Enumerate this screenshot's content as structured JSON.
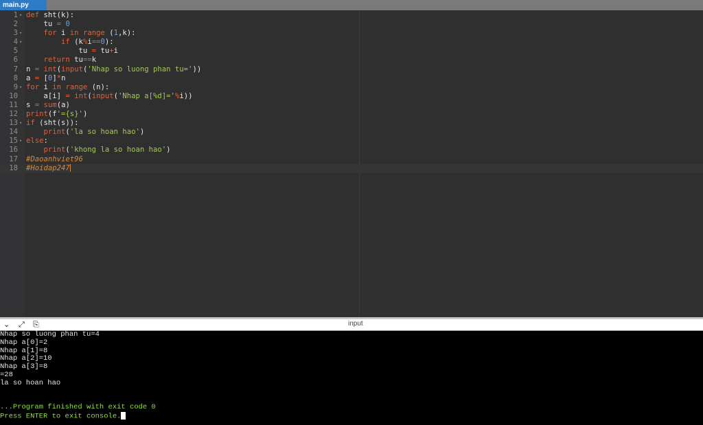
{
  "tab": {
    "label": "main.py"
  },
  "editor": {
    "active_line": 18,
    "folds": [
      1,
      3,
      4,
      9,
      13,
      15
    ],
    "lines": [
      [
        [
          "k",
          "def"
        ],
        [
          "p",
          " sht(k):"
        ]
      ],
      [
        [
          "p",
          "    tu "
        ],
        [
          "k",
          "="
        ],
        [
          "p",
          " "
        ],
        [
          "n",
          "0"
        ]
      ],
      [
        [
          "p",
          "    "
        ],
        [
          "k",
          "for"
        ],
        [
          "p",
          " i "
        ],
        [
          "k",
          "in"
        ],
        [
          "p",
          " "
        ],
        [
          "k",
          "range"
        ],
        [
          "p",
          " ("
        ],
        [
          "n",
          "1"
        ],
        [
          "p",
          ",k):"
        ]
      ],
      [
        [
          "p",
          "        "
        ],
        [
          "k",
          "if"
        ],
        [
          "p",
          " (k"
        ],
        [
          "k",
          "%"
        ],
        [
          "p",
          "i"
        ],
        [
          "k",
          "=="
        ],
        [
          "n",
          "0"
        ],
        [
          "p",
          "):"
        ]
      ],
      [
        [
          "p",
          "            tu "
        ],
        [
          "k",
          "="
        ],
        [
          "p",
          " tu"
        ],
        [
          "k",
          "+"
        ],
        [
          "p",
          "i"
        ]
      ],
      [
        [
          "p",
          "    "
        ],
        [
          "k",
          "return"
        ],
        [
          "p",
          " tu"
        ],
        [
          "k",
          "=="
        ],
        [
          "p",
          "k"
        ]
      ],
      [
        [
          "p",
          "n "
        ],
        [
          "k",
          "="
        ],
        [
          "p",
          " "
        ],
        [
          "k",
          "int"
        ],
        [
          "p",
          "("
        ],
        [
          "k",
          "input"
        ],
        [
          "p",
          "("
        ],
        [
          "s",
          "'Nhap so luong phan tu='"
        ],
        [
          "p",
          "))"
        ]
      ],
      [
        [
          "p",
          "a "
        ],
        [
          "k",
          "="
        ],
        [
          "p",
          " ["
        ],
        [
          "n",
          "0"
        ],
        [
          "p",
          "]"
        ],
        [
          "k",
          "*"
        ],
        [
          "p",
          "n"
        ]
      ],
      [
        [
          "k",
          "for"
        ],
        [
          "p",
          " i "
        ],
        [
          "k",
          "in"
        ],
        [
          "p",
          " "
        ],
        [
          "k",
          "range"
        ],
        [
          "p",
          " (n):"
        ]
      ],
      [
        [
          "p",
          "    a[i] "
        ],
        [
          "k",
          "="
        ],
        [
          "p",
          " "
        ],
        [
          "k",
          "int"
        ],
        [
          "p",
          "("
        ],
        [
          "k",
          "input"
        ],
        [
          "p",
          "("
        ],
        [
          "s",
          "'Nhap a[%d]='"
        ],
        [
          "k",
          "%"
        ],
        [
          "p",
          "i))"
        ]
      ],
      [
        [
          "p",
          "s "
        ],
        [
          "k",
          "="
        ],
        [
          "p",
          " "
        ],
        [
          "k",
          "sum"
        ],
        [
          "p",
          "(a)"
        ]
      ],
      [
        [
          "k",
          "print"
        ],
        [
          "p",
          "(f"
        ],
        [
          "s",
          "'={s}'"
        ],
        [
          "p",
          ")"
        ]
      ],
      [
        [
          "k",
          "if"
        ],
        [
          "p",
          " (sht(s)):"
        ]
      ],
      [
        [
          "p",
          "    "
        ],
        [
          "k",
          "print"
        ],
        [
          "p",
          "("
        ],
        [
          "s",
          "'la so hoan hao'"
        ],
        [
          "p",
          ")"
        ]
      ],
      [
        [
          "k",
          "else"
        ],
        [
          "p",
          ":"
        ]
      ],
      [
        [
          "p",
          "    "
        ],
        [
          "k",
          "print"
        ],
        [
          "p",
          "("
        ],
        [
          "s",
          "'khong la so hoan hao'"
        ],
        [
          "p",
          ")"
        ]
      ],
      [
        [
          "c",
          "#Daoanhviet96"
        ]
      ],
      [
        [
          "c",
          "#Hoidap247"
        ]
      ]
    ]
  },
  "console_toolbar": {
    "label": "input"
  },
  "console": {
    "lines": [
      "Nhap so luong phan tu=4",
      "Nhap a[0]=2",
      "Nhap a[1]=8",
      "Nhap a[2]=10",
      "Nhap a[3]=8",
      "=28",
      "la so hoan hao",
      "",
      ""
    ],
    "finished": "...Program finished with exit code 0",
    "press_enter": "Press ENTER to exit console."
  }
}
